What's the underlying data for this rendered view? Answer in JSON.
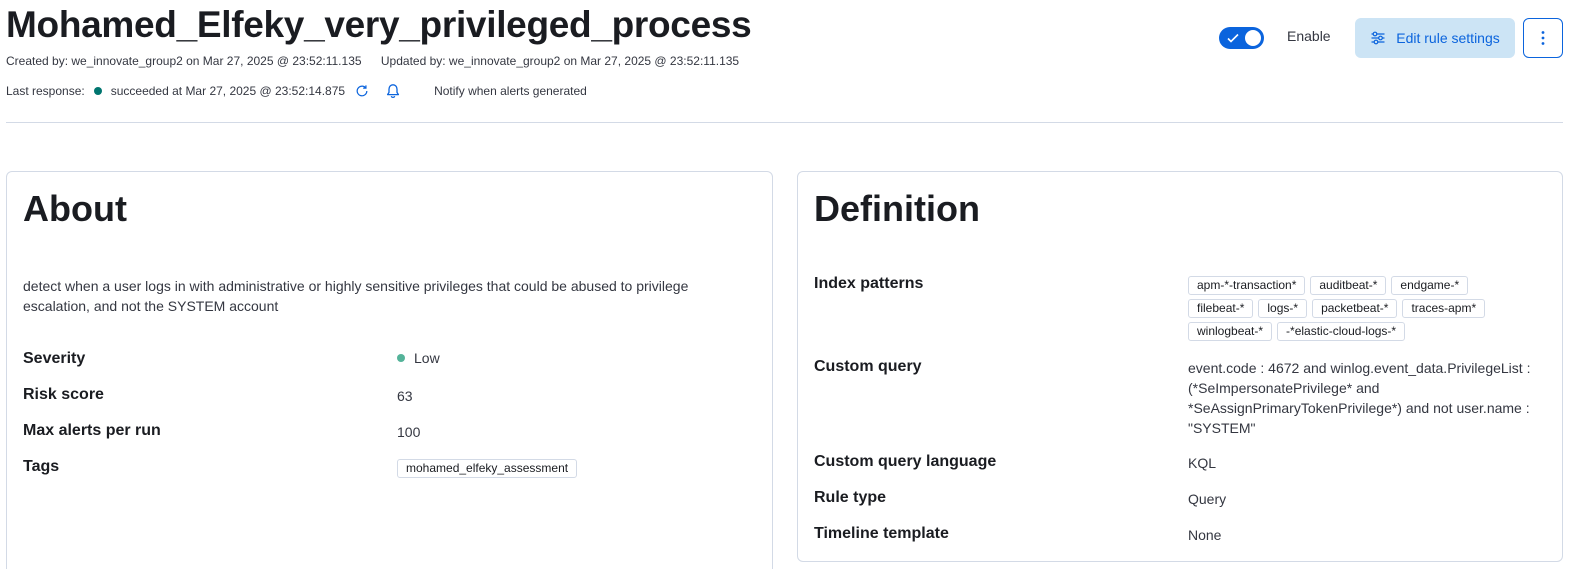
{
  "header": {
    "title": "Mohamed_Elfeky_very_privileged_process",
    "created": "Created by: we_innovate_group2 on Mar 27, 2025 @ 23:52:11.135",
    "updated": "Updated by: we_innovate_group2 on Mar 27, 2025 @ 23:52:11.135",
    "last_response_label": "Last response:",
    "last_response_value": "succeeded at Mar 27, 2025 @ 23:52:14.875",
    "notify": "Notify when alerts generated",
    "enable_label": "Enable",
    "enable_on": true,
    "edit_button": "Edit rule settings"
  },
  "about": {
    "title": "About",
    "description": "detect when a user logs in with administrative or highly sensitive privileges that could be abused to privilege escalation, and not the SYSTEM account",
    "severity_label": "Severity",
    "severity_value": "Low",
    "risk_label": "Risk score",
    "risk_value": "63",
    "max_alerts_label": "Max alerts per run",
    "max_alerts_value": "100",
    "tags_label": "Tags",
    "tags": [
      "mohamed_elfeky_assessment"
    ]
  },
  "definition": {
    "title": "Definition",
    "index_label": "Index patterns",
    "index_patterns": [
      "apm-*-transaction*",
      "auditbeat-*",
      "endgame-*",
      "filebeat-*",
      "logs-*",
      "packetbeat-*",
      "traces-apm*",
      "winlogbeat-*",
      "-*elastic-cloud-logs-*"
    ],
    "query_label": "Custom query",
    "query_value": "event.code : 4672 and winlog.event_data.PrivilegeList : (*SeImpersonatePrivilege* and *SeAssignPrimaryTokenPrivilege*) and not user.name : \"SYSTEM\"",
    "language_label": "Custom query language",
    "language_value": "KQL",
    "rule_type_label": "Rule type",
    "rule_type_value": "Query",
    "timeline_label": "Timeline template",
    "timeline_value": "None"
  },
  "colors": {
    "primary": "#0b64dd",
    "success": "#00756f",
    "severity_low": "#54b399"
  }
}
